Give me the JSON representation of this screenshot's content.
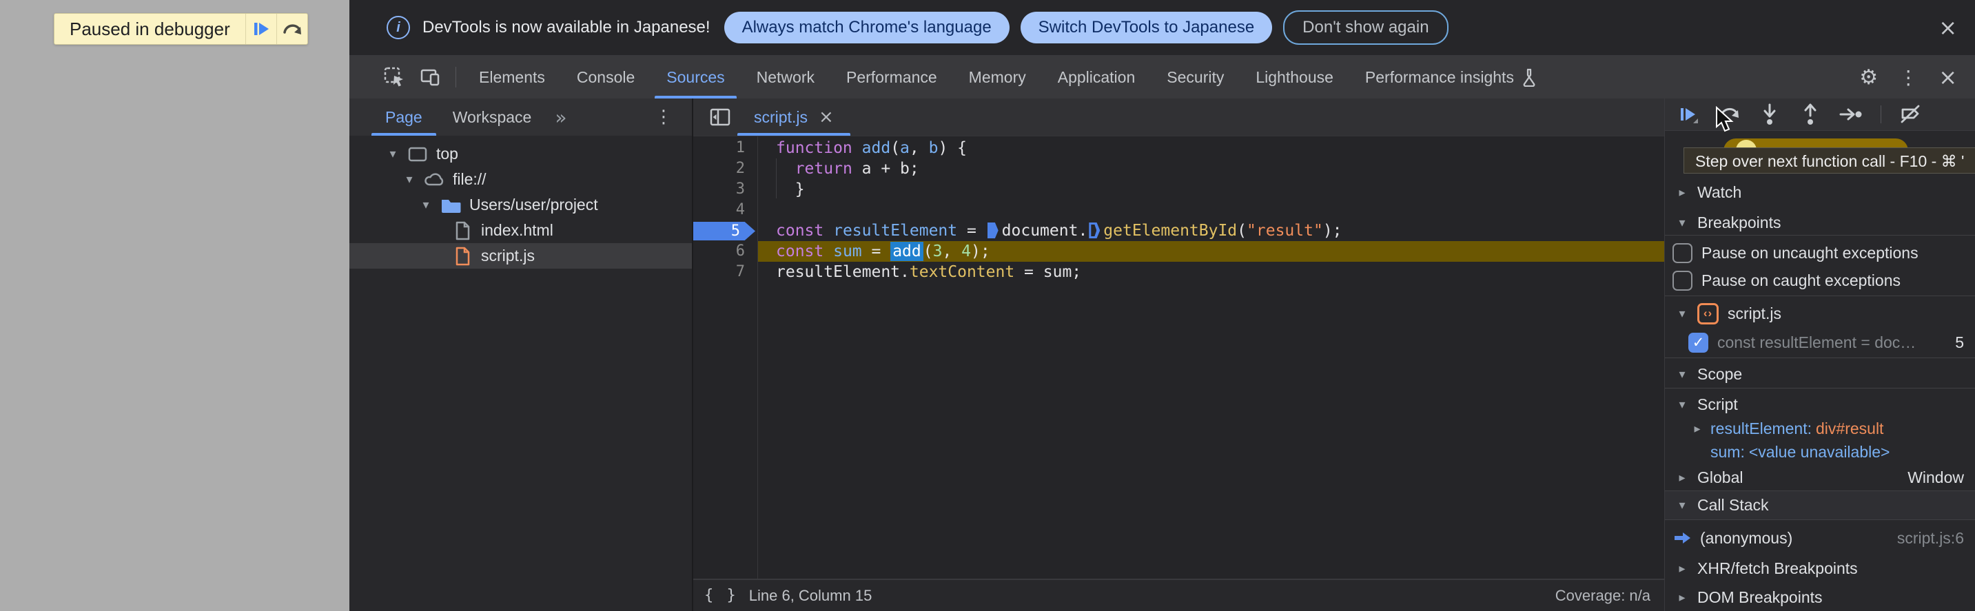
{
  "page": {
    "paused_banner": {
      "label": "Paused in debugger"
    }
  },
  "infobar": {
    "message": "DevTools is now available in Japanese!",
    "primary_button": "Always match Chrome's language",
    "secondary_button": "Switch DevTools to Japanese",
    "dismiss_button": "Don't show again",
    "close": "×"
  },
  "main_tabs": {
    "items": [
      "Elements",
      "Console",
      "Sources",
      "Network",
      "Performance",
      "Memory",
      "Application",
      "Security",
      "Lighthouse",
      "Performance insights"
    ],
    "selected": "Sources"
  },
  "sources_nav": {
    "tab_page": "Page",
    "tab_workspace": "Workspace",
    "more_tabs_chevron": "»",
    "tree": [
      {
        "label": "top"
      },
      {
        "label": "file://"
      },
      {
        "label": "Users/user/project"
      },
      {
        "label": "index.html"
      },
      {
        "label": "script.js"
      }
    ]
  },
  "editor": {
    "open_tab": "script.js",
    "close_tab": "×",
    "code_lines": [
      {
        "n": "1",
        "tokens": [
          [
            "kw",
            "function"
          ],
          [
            "pl",
            " "
          ],
          [
            "var",
            "add"
          ],
          [
            "pl",
            "("
          ],
          [
            "var",
            "a"
          ],
          [
            "pl",
            ", "
          ],
          [
            "var",
            "b"
          ],
          [
            "pl",
            ") {"
          ]
        ]
      },
      {
        "n": "2",
        "tokens": [
          [
            "pl",
            "  "
          ],
          [
            "kw",
            "return"
          ],
          [
            "pl",
            " a + b;"
          ]
        ]
      },
      {
        "n": "3",
        "tokens": [
          [
            "pl",
            "  }"
          ]
        ]
      },
      {
        "n": "4",
        "tokens": []
      },
      {
        "n": "5",
        "breakpoint": true,
        "tokens": [
          [
            "kw",
            "const"
          ],
          [
            "pl",
            " "
          ],
          [
            "var",
            "resultElement"
          ],
          [
            "pl",
            " = "
          ],
          [
            "m1",
            ""
          ],
          [
            "pl",
            "document."
          ],
          [
            "m2",
            ""
          ],
          [
            "fn",
            "getElementById"
          ],
          [
            "pl",
            "("
          ],
          [
            "str",
            "\"result\""
          ],
          [
            "pl",
            ");"
          ]
        ]
      },
      {
        "n": "6",
        "paused": true,
        "tokens": [
          [
            "kw",
            "const"
          ],
          [
            "pl",
            " "
          ],
          [
            "var",
            "sum"
          ],
          [
            "pl",
            " = "
          ],
          [
            "sel",
            "add"
          ],
          [
            "pl",
            "("
          ],
          [
            "nm",
            "3"
          ],
          [
            "pl",
            ", "
          ],
          [
            "nm",
            "4"
          ],
          [
            "pl",
            ");"
          ]
        ]
      },
      {
        "n": "7",
        "tokens": [
          [
            "pl",
            "resultElement."
          ],
          [
            "fn",
            "textContent"
          ],
          [
            "pl",
            " = sum;"
          ]
        ]
      }
    ],
    "status": {
      "cursor_position": "Line 6, Column 15",
      "pretty_print": "{ }",
      "coverage": "Coverage: n/a"
    }
  },
  "debugger": {
    "tooltip": "Step over next function call - F10 - ⌘ '",
    "watch": "Watch",
    "breakpoints": "Breakpoints",
    "pause_uncaught": "Pause on uncaught exceptions",
    "pause_caught": "Pause on caught exceptions",
    "breakpoint_group": "script.js",
    "breakpoint_item": {
      "text": "const resultElement = doc…",
      "line": "5"
    },
    "scope": "Scope",
    "scope_script": "Script",
    "var1": {
      "name": "resultElement",
      "sep": ": ",
      "value": "div#result"
    },
    "var2": {
      "name": "sum",
      "sep": ": ",
      "value": "<value unavailable>"
    },
    "global": {
      "label": "Global",
      "value": "Window"
    },
    "call_stack": "Call Stack",
    "frame": {
      "name": "(anonymous)",
      "location": "script.js:6"
    },
    "xhr": "XHR/fetch Breakpoints",
    "dom": "DOM Breakpoints"
  },
  "colors": {
    "accent_blue": "#7CACF8",
    "paused_line_bg": "#6B5702",
    "breakpoint_blue": "#4D82E8",
    "keyword_purple": "#C47EDE",
    "function_gold": "#E2C163",
    "string_orange": "#F08D5A",
    "number_green": "#A5DFA8"
  }
}
